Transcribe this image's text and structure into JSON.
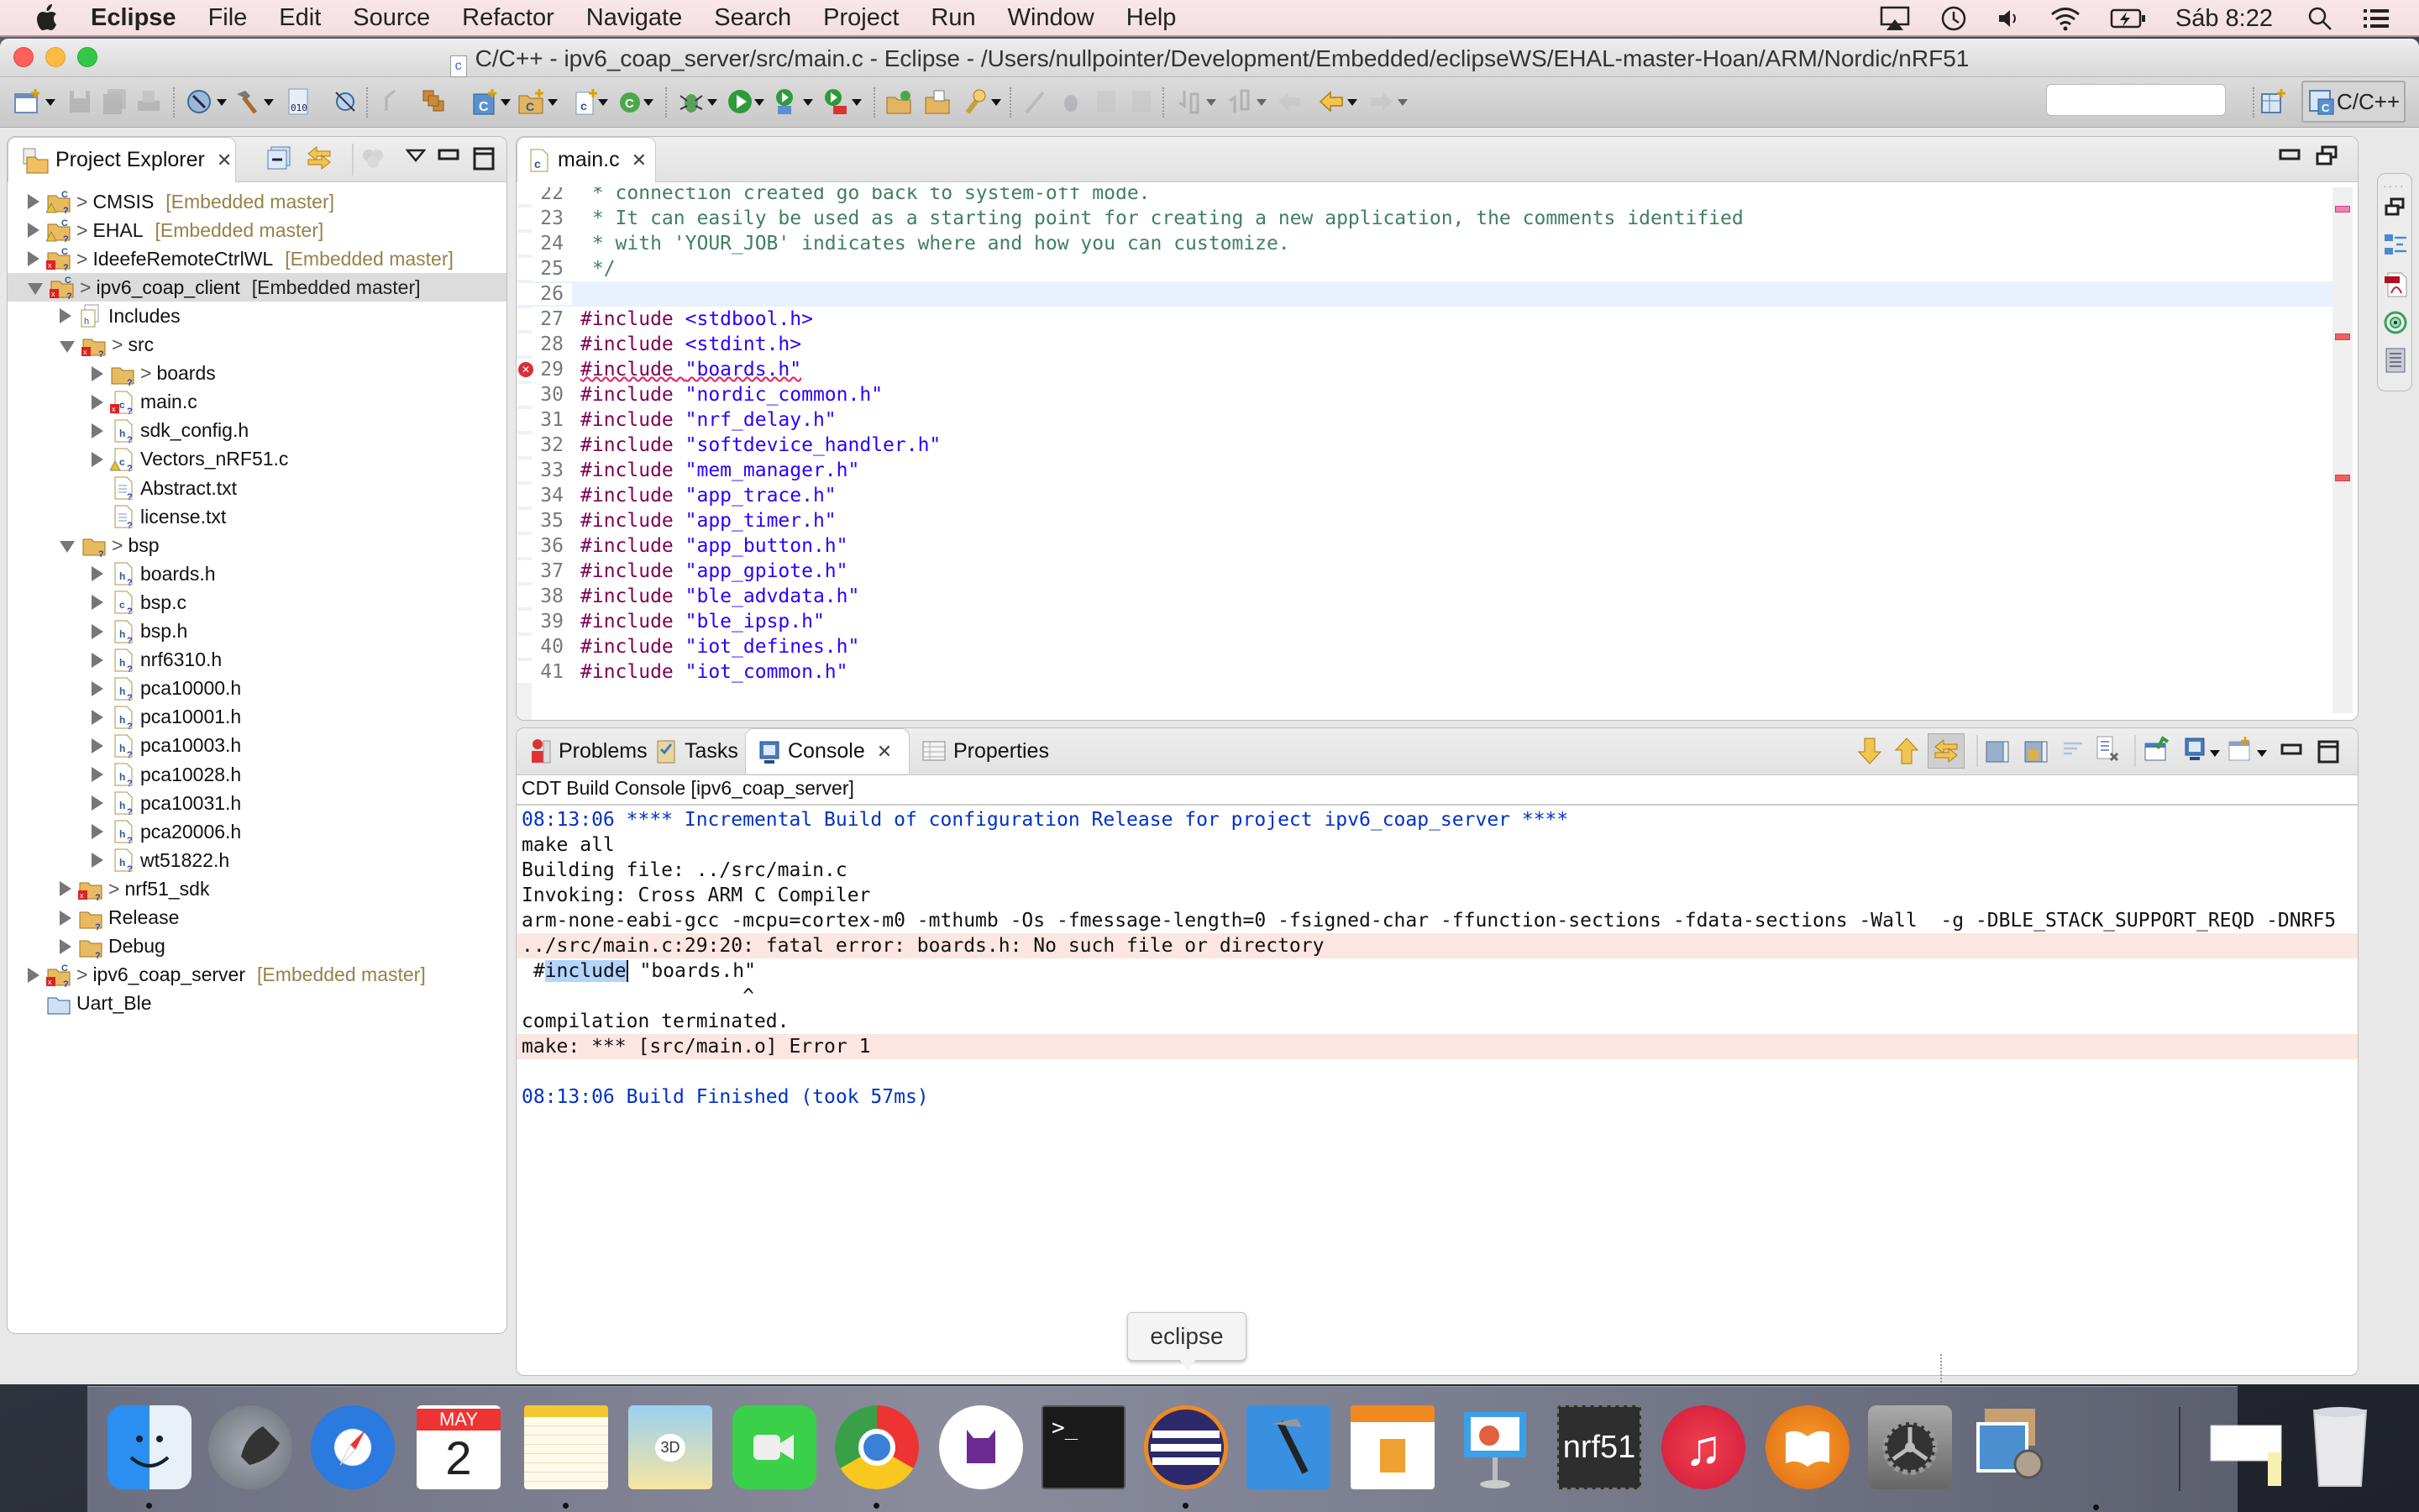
{
  "menubar": {
    "app_name": "Eclipse",
    "items": [
      "File",
      "Edit",
      "Source",
      "Refactor",
      "Navigate",
      "Search",
      "Project",
      "Run",
      "Window",
      "Help"
    ],
    "status_icons": [
      "airplay-icon",
      "time-machine-icon",
      "volume-icon",
      "wifi-icon",
      "battery-charging-icon"
    ],
    "clock": "Sáb 8:22"
  },
  "window": {
    "title": "C/C++ - ipv6_coap_server/src/main.c - Eclipse - /Users/nullpointer/Development/Embedded/eclipseWS/EHAL-master-Hoan/ARM/Nordic/nRF51",
    "title_doc_icon_letter": "c",
    "perspective_label": "C/C++",
    "search_value": ""
  },
  "project_explorer": {
    "tab_label": "Project Explorer",
    "tree": [
      {
        "label": "CMSIS",
        "decor": "[Embedded master]",
        "level": 0,
        "expanded": false,
        "prefix": ">",
        "icon": "project-warning-icon"
      },
      {
        "label": "EHAL",
        "decor": "[Embedded master]",
        "level": 0,
        "expanded": false,
        "prefix": ">",
        "icon": "project-warning-icon"
      },
      {
        "label": "IdeefeRemoteCtrlWL",
        "decor": "[Embedded master]",
        "level": 0,
        "expanded": false,
        "prefix": ">",
        "icon": "project-error-icon"
      },
      {
        "label": "ipv6_coap_client",
        "decor": "[Embedded master]",
        "level": 0,
        "expanded": true,
        "prefix": ">",
        "icon": "project-error-icon",
        "selected": true
      },
      {
        "label": "Includes",
        "level": 1,
        "expanded": false,
        "icon": "includes-icon"
      },
      {
        "label": "src",
        "level": 1,
        "expanded": true,
        "prefix": ">",
        "icon": "source-folder-error-icon"
      },
      {
        "label": "boards",
        "level": 2,
        "expanded": false,
        "prefix": ">",
        "icon": "folder-icon"
      },
      {
        "label": "main.c",
        "level": 2,
        "expanded": false,
        "icon": "c-file-error-icon"
      },
      {
        "label": "sdk_config.h",
        "level": 2,
        "expanded": false,
        "icon": "h-file-icon"
      },
      {
        "label": "Vectors_nRF51.c",
        "level": 2,
        "expanded": false,
        "icon": "c-file-warning-icon"
      },
      {
        "label": "Abstract.txt",
        "level": 2,
        "leaf": true,
        "icon": "text-file-icon"
      },
      {
        "label": "license.txt",
        "level": 2,
        "leaf": true,
        "icon": "text-file-icon"
      },
      {
        "label": "bsp",
        "level": 1,
        "expanded": true,
        "prefix": ">",
        "icon": "folder-icon"
      },
      {
        "label": "boards.h",
        "level": 2,
        "expanded": false,
        "icon": "h-file-icon"
      },
      {
        "label": "bsp.c",
        "level": 2,
        "expanded": false,
        "icon": "c-file-icon"
      },
      {
        "label": "bsp.h",
        "level": 2,
        "expanded": false,
        "icon": "h-file-icon"
      },
      {
        "label": "nrf6310.h",
        "level": 2,
        "expanded": false,
        "icon": "h-file-icon"
      },
      {
        "label": "pca10000.h",
        "level": 2,
        "expanded": false,
        "icon": "h-file-icon"
      },
      {
        "label": "pca10001.h",
        "level": 2,
        "expanded": false,
        "icon": "h-file-icon"
      },
      {
        "label": "pca10003.h",
        "level": 2,
        "expanded": false,
        "icon": "h-file-icon"
      },
      {
        "label": "pca10028.h",
        "level": 2,
        "expanded": false,
        "icon": "h-file-icon"
      },
      {
        "label": "pca10031.h",
        "level": 2,
        "expanded": false,
        "icon": "h-file-icon"
      },
      {
        "label": "pca20006.h",
        "level": 2,
        "expanded": false,
        "icon": "h-file-icon"
      },
      {
        "label": "wt51822.h",
        "level": 2,
        "expanded": false,
        "icon": "h-file-icon"
      },
      {
        "label": "nrf51_sdk",
        "level": 1,
        "expanded": false,
        "prefix": ">",
        "icon": "folder-error-icon"
      },
      {
        "label": "Release",
        "level": 1,
        "expanded": false,
        "icon": "folder-icon"
      },
      {
        "label": "Debug",
        "level": 1,
        "expanded": false,
        "icon": "folder-icon"
      },
      {
        "label": "ipv6_coap_server",
        "decor": "[Embedded master]",
        "level": 0,
        "expanded": false,
        "prefix": ">",
        "icon": "project-error-icon"
      },
      {
        "label": "Uart_Ble",
        "level": 0,
        "leaf": true,
        "icon": "closed-project-icon"
      }
    ]
  },
  "editor": {
    "tab_label": "main.c",
    "lines": [
      {
        "n": "22",
        "type": "comment",
        "text": " * connection created go back to system-off mode."
      },
      {
        "n": "23",
        "type": "comment",
        "text": " * It can easily be used as a starting point for creating a new application, the comments identified"
      },
      {
        "n": "24",
        "type": "comment",
        "text": " * with 'YOUR_JOB' indicates where and how you can customize."
      },
      {
        "n": "25",
        "type": "comment",
        "text": " */"
      },
      {
        "n": "26",
        "type": "blank",
        "text": "",
        "current": true
      },
      {
        "n": "27",
        "type": "include",
        "directive": "#include",
        "arg": "<stdbool.h>"
      },
      {
        "n": "28",
        "type": "include",
        "directive": "#include",
        "arg": "<stdint.h>"
      },
      {
        "n": "29",
        "type": "include",
        "directive": "#include",
        "arg": "\"boards.h\"",
        "error": true
      },
      {
        "n": "30",
        "type": "include",
        "directive": "#include",
        "arg": "\"nordic_common.h\""
      },
      {
        "n": "31",
        "type": "include",
        "directive": "#include",
        "arg": "\"nrf_delay.h\""
      },
      {
        "n": "32",
        "type": "include",
        "directive": "#include",
        "arg": "\"softdevice_handler.h\""
      },
      {
        "n": "33",
        "type": "include",
        "directive": "#include",
        "arg": "\"mem_manager.h\""
      },
      {
        "n": "34",
        "type": "include",
        "directive": "#include",
        "arg": "\"app_trace.h\""
      },
      {
        "n": "35",
        "type": "include",
        "directive": "#include",
        "arg": "\"app_timer.h\""
      },
      {
        "n": "36",
        "type": "include",
        "directive": "#include",
        "arg": "\"app_button.h\""
      },
      {
        "n": "37",
        "type": "include",
        "directive": "#include",
        "arg": "\"app_gpiote.h\""
      },
      {
        "n": "38",
        "type": "include",
        "directive": "#include",
        "arg": "\"ble_advdata.h\""
      },
      {
        "n": "39",
        "type": "include",
        "directive": "#include",
        "arg": "\"ble_ipsp.h\""
      },
      {
        "n": "40",
        "type": "include",
        "directive": "#include",
        "arg": "\"iot_defines.h\""
      },
      {
        "n": "41",
        "type": "include",
        "directive": "#include",
        "arg": "\"iot_common.h\""
      }
    ]
  },
  "bottom_panel": {
    "tabs": [
      {
        "label": "Problems",
        "icon": "problems-icon"
      },
      {
        "label": "Tasks",
        "icon": "tasks-icon"
      },
      {
        "label": "Console",
        "icon": "console-icon",
        "active": true
      },
      {
        "label": "Properties",
        "icon": "properties-icon"
      }
    ],
    "console_title": "CDT Build Console [ipv6_coap_server]",
    "lines": [
      {
        "text": "08:13:06 **** Incremental Build of configuration Release for project ipv6_coap_server ****",
        "style": "blue"
      },
      {
        "text": "make all",
        "style": "normal"
      },
      {
        "text": "Building file: ../src/main.c",
        "style": "normal"
      },
      {
        "text": "Invoking: Cross ARM C Compiler",
        "style": "normal"
      },
      {
        "text": "arm-none-eabi-gcc -mcpu=cortex-m0 -mthumb -Os -fmessage-length=0 -fsigned-char -ffunction-sections -fdata-sections -Wall  -g -DBLE_STACK_SUPPORT_REQD -DNRF5",
        "style": "normal"
      },
      {
        "text": "../src/main.c:29:20: fatal error: boards.h: No such file or directory",
        "style": "error"
      },
      {
        "text": " #include \"boards.h\"",
        "style": "normal",
        "highlight": "include"
      },
      {
        "text": "                   ^",
        "style": "normal"
      },
      {
        "text": "compilation terminated.",
        "style": "normal"
      },
      {
        "text": "make: *** [src/main.o] Error 1",
        "style": "error"
      },
      {
        "text": "",
        "style": "normal"
      },
      {
        "text": "08:13:06 Build Finished (took 57ms)",
        "style": "blue"
      }
    ]
  },
  "dock": {
    "tooltip": "eclipse",
    "calendar_month": "MAY",
    "calendar_day": "2",
    "nrf51_label": "nrf51",
    "items": [
      "Finder",
      "Launchpad",
      "Safari",
      "Calendar",
      "Notes",
      "Maps",
      "FaceTime",
      "Chrome",
      "GitHub",
      "Terminal",
      "Eclipse",
      "Xcode",
      "Pages",
      "Keynote",
      "nrf51",
      "iTunes",
      "iBooks",
      "System Preferences",
      "Preview",
      "Documents",
      "Trash"
    ]
  },
  "colors": {
    "keyword": "#7f0055",
    "string": "#2a00ff",
    "comment": "#3f7f5f",
    "console_blue": "#0030c8",
    "error_bg": "#fbe6e1",
    "decoration": "#99804a"
  }
}
